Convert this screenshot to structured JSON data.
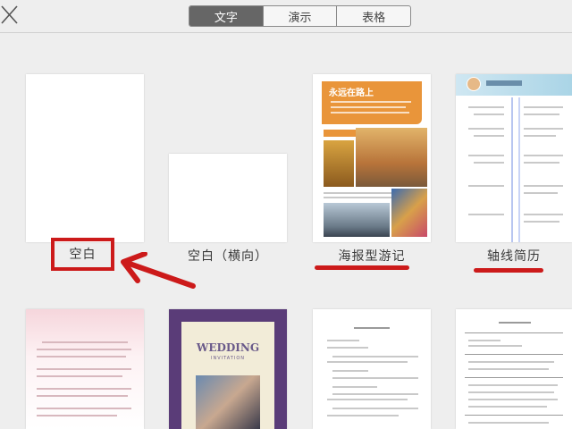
{
  "tabs": [
    {
      "label": "文字",
      "active": true
    },
    {
      "label": "演示",
      "active": false
    },
    {
      "label": "表格",
      "active": false
    }
  ],
  "templates": [
    {
      "label": "空白"
    },
    {
      "label": "空白（横向）"
    },
    {
      "label": "海报型游记",
      "title": "永远在路上"
    },
    {
      "label": "轴线简历"
    },
    {
      "label": ""
    },
    {
      "label": "",
      "title": "WEDDING",
      "subtitle": "INVITATION"
    },
    {
      "label": ""
    },
    {
      "label": ""
    }
  ],
  "colors": {
    "accent": "#cc1a1a",
    "active_tab": "#666666"
  }
}
